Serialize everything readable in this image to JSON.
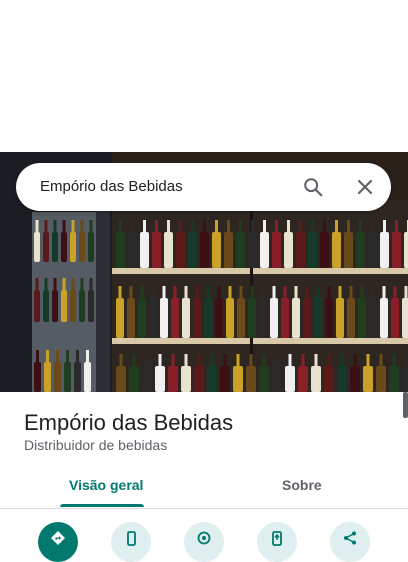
{
  "search": {
    "query": "Empório das Bebidas"
  },
  "place": {
    "name": "Empório das Bebidas",
    "category": "Distribuidor de bebidas"
  },
  "tabs": [
    {
      "label": "Visão geral",
      "active": true
    },
    {
      "label": "Sobre",
      "active": false
    }
  ],
  "actions": [
    {
      "icon": "directions-icon"
    },
    {
      "icon": "phone-icon"
    },
    {
      "icon": "location-icon"
    },
    {
      "icon": "send-to-phone-icon"
    },
    {
      "icon": "share-icon"
    }
  ],
  "colors": {
    "accent": "#01796f",
    "action_bg": "#dfeeee",
    "text": "#202124",
    "secondary": "#5f6368"
  }
}
